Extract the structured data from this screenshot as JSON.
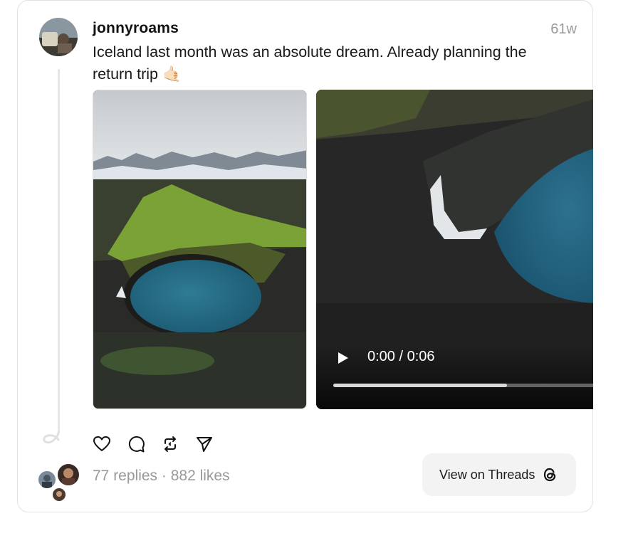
{
  "post": {
    "username": "jonnyroams",
    "time": "61w",
    "text": "Iceland last month was an absolute dream. Already planning the return trip 🤙🏻"
  },
  "media": {
    "video": {
      "time_display": "0:00 / 0:06",
      "progress_fraction": 0.66
    }
  },
  "actions": [
    "heart-icon",
    "comment-icon",
    "repost-icon",
    "share-icon"
  ],
  "stats": {
    "text": "77 replies · 882 likes"
  },
  "view_button": {
    "label": "View on Threads"
  }
}
